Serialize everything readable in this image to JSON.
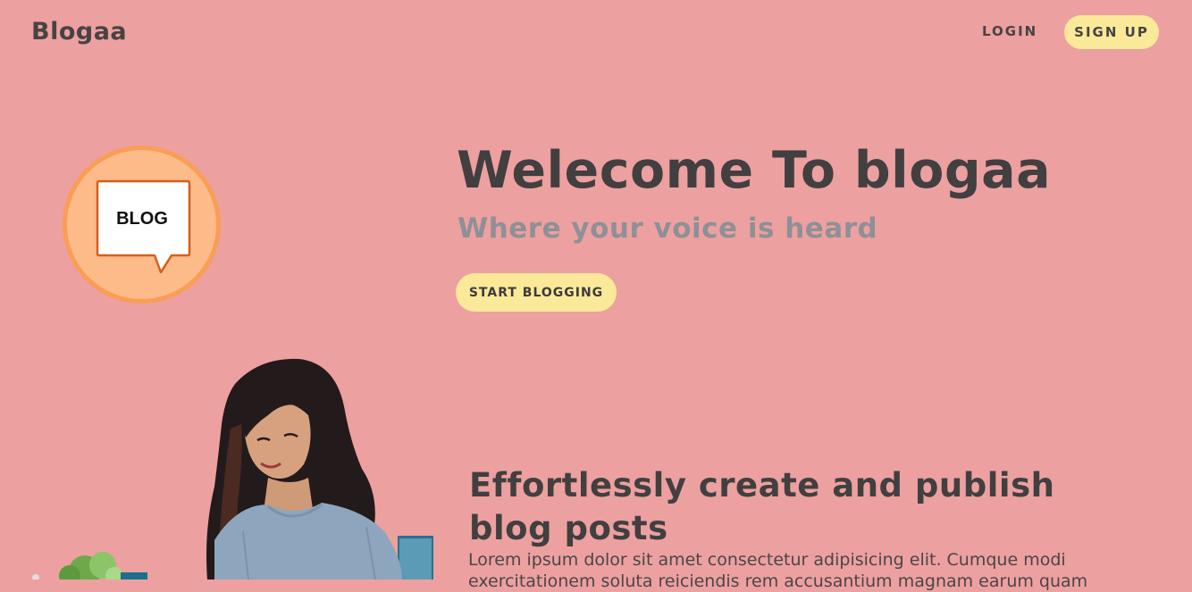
{
  "navbar": {
    "brand": "Blogaa",
    "login_label": "LOGIN",
    "signup_label": "SIGN UP"
  },
  "logo": {
    "badge_text": "BLOG",
    "icon": "speech-bubble-icon"
  },
  "hero": {
    "title": "Welecome To blogaa",
    "subtitle": "Where your voice is heard",
    "cta_label": "START BLOGGING"
  },
  "feature": {
    "title": "Effortlessly create and publish blog posts",
    "text": "Lorem ipsum dolor sit amet consectetur adipisicing elit. Cumque modi exercitationem soluta reiciendis rem accusantium magnam earum quam"
  },
  "colors": {
    "background": "#eda0a0",
    "accent_button": "#fbe99a",
    "logo_fill": "#fdbb8a",
    "logo_ring": "#f99e55",
    "bubble_border": "#d65f1c"
  }
}
